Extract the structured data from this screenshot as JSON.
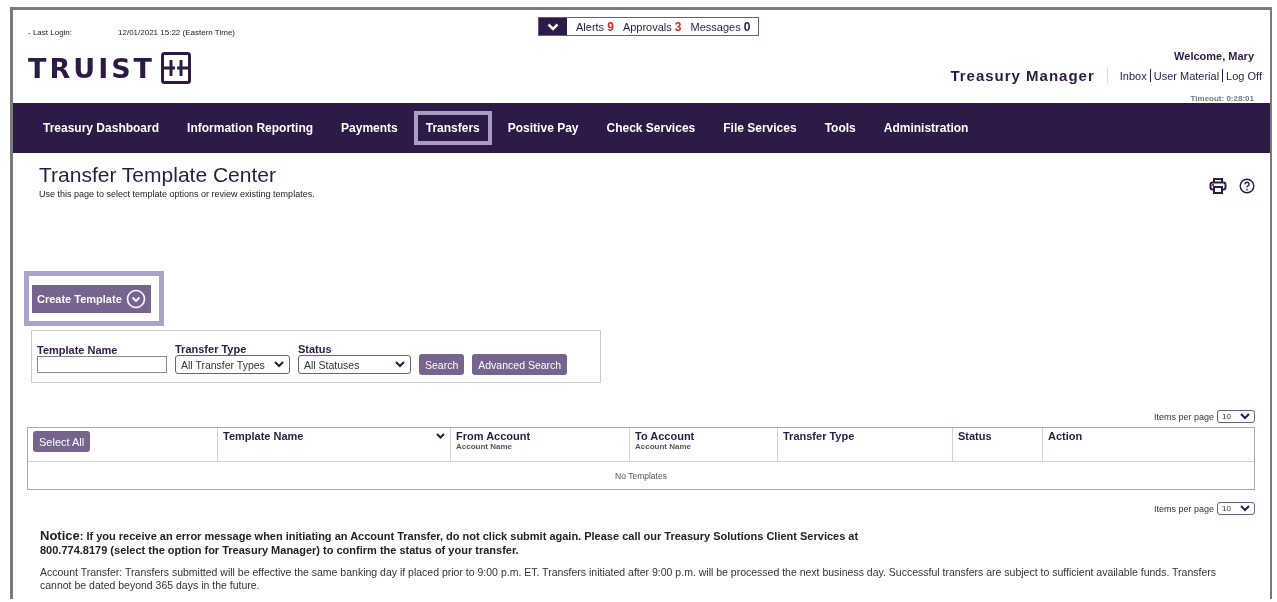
{
  "header": {
    "last_login_label": "- Last Login:",
    "last_login_value": "12/01/2021 15:22 (Eastern Time)",
    "logo": "TRUIST",
    "counters": [
      {
        "label": "Alerts",
        "count": "9",
        "color": "#e8242a"
      },
      {
        "label": "Approvals",
        "count": "3",
        "color": "#e8242a"
      },
      {
        "label": "Messages",
        "count": "0",
        "color": "#2e1a47"
      }
    ],
    "welcome": "Welcome, Mary",
    "app_name": "Treasury Manager",
    "links": [
      "Inbox",
      "User Material",
      "Log Off"
    ],
    "timeout": "Timeout: 0:28:01"
  },
  "nav": [
    {
      "label": "Treasury Dashboard",
      "selected": false
    },
    {
      "label": "Information Reporting",
      "selected": false
    },
    {
      "label": "Payments",
      "selected": false
    },
    {
      "label": "Transfers",
      "selected": true
    },
    {
      "label": "Positive Pay",
      "selected": false
    },
    {
      "label": "Check Services",
      "selected": false
    },
    {
      "label": "File Services",
      "selected": false
    },
    {
      "label": "Tools",
      "selected": false
    },
    {
      "label": "Administration",
      "selected": false
    }
  ],
  "page": {
    "title": "Transfer Template Center",
    "subtitle": "Use this page to select template options or review existing templates."
  },
  "create_button": {
    "label": "Create Template",
    "highlighted": true
  },
  "search": {
    "fields": [
      {
        "kind": "text",
        "label": "Template Name"
      },
      {
        "kind": "select",
        "label": "Transfer Type",
        "value": "All Transfer Types"
      },
      {
        "kind": "select",
        "label": "Status",
        "value": "All Statuses"
      }
    ],
    "buttons": [
      "Search",
      "Advanced Search"
    ]
  },
  "pager_top": {
    "label": "Items per page",
    "value": "10"
  },
  "table": {
    "select_all": "Select All",
    "columns": [
      {
        "label": "Template Name",
        "sortable": true
      },
      {
        "label": "From Account",
        "sub": "Account Name",
        "sortable": false
      },
      {
        "label": "To Account",
        "sub": "Account Name",
        "sortable": false
      },
      {
        "label": "Transfer Type",
        "sortable": false
      },
      {
        "label": "Status",
        "sortable": false
      },
      {
        "label": "Action",
        "sortable": false
      }
    ],
    "empty": "No Templates"
  },
  "pager_bottom": {
    "label": "Items per page",
    "value": "10"
  },
  "notice": "**Notice**: If you receive an error message when initiating an Account Transfer, do not click submit again. Please call our Treasury Solutions Client Services at 800.774.8179 (select the option for Treasury Manager) to confirm the status of your transfer.",
  "disclaimer": "Account Transfer: Transfers submitted will be effective the same banking day if placed prior to 9:00 p.m. ET. Transfers initiated after 9:00 p.m. will be processed the next business day. Successful transfers are subject to sufficient available funds. Transfers cannot be dated beyond 365 days in the future."
}
